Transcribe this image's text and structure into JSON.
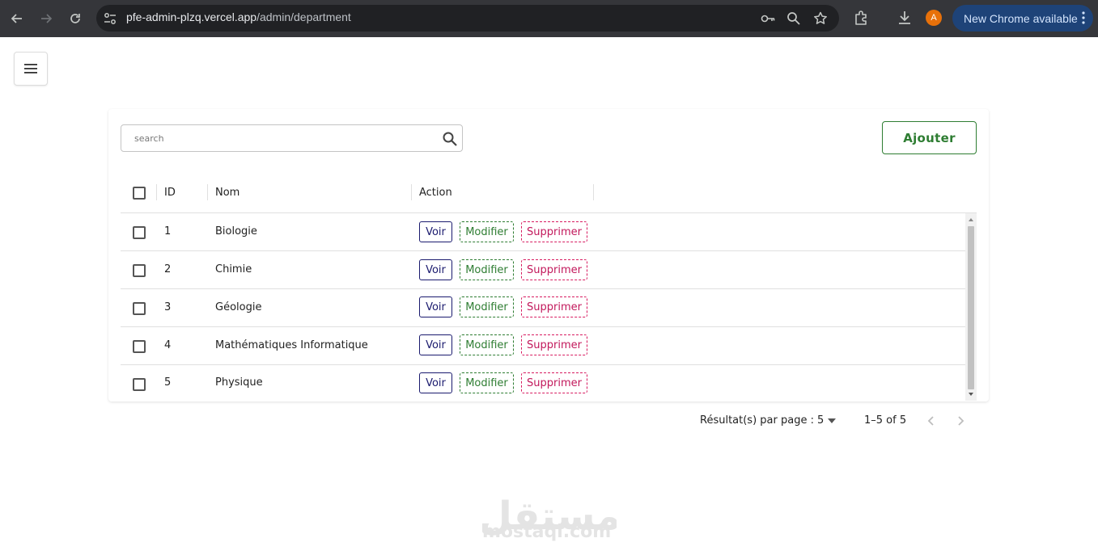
{
  "browser": {
    "url_host": "pfe-admin-plzq.vercel.app",
    "url_path": "/admin/department",
    "profile_initial": "A",
    "update_label": "New Chrome available"
  },
  "search": {
    "placeholder": "search"
  },
  "toolbar": {
    "add_label": "Ajouter"
  },
  "table": {
    "columns": [
      "ID",
      "Nom",
      "Action"
    ],
    "rows": [
      {
        "id": "1",
        "nom": "Biologie"
      },
      {
        "id": "2",
        "nom": "Chimie"
      },
      {
        "id": "3",
        "nom": "Géologie"
      },
      {
        "id": "4",
        "nom": "Mathématiques Informatique"
      },
      {
        "id": "5",
        "nom": "Physique"
      }
    ],
    "actions": {
      "view": "Voir",
      "edit": "Modifier",
      "delete": "Supprimer"
    }
  },
  "pagination": {
    "rows_per_page_label": "Résultat(s) par page :",
    "rows_per_page": "5",
    "range": "1–5 of 5"
  },
  "watermark": {
    "text": "mostaql.com",
    "arabic": "مستقل"
  }
}
